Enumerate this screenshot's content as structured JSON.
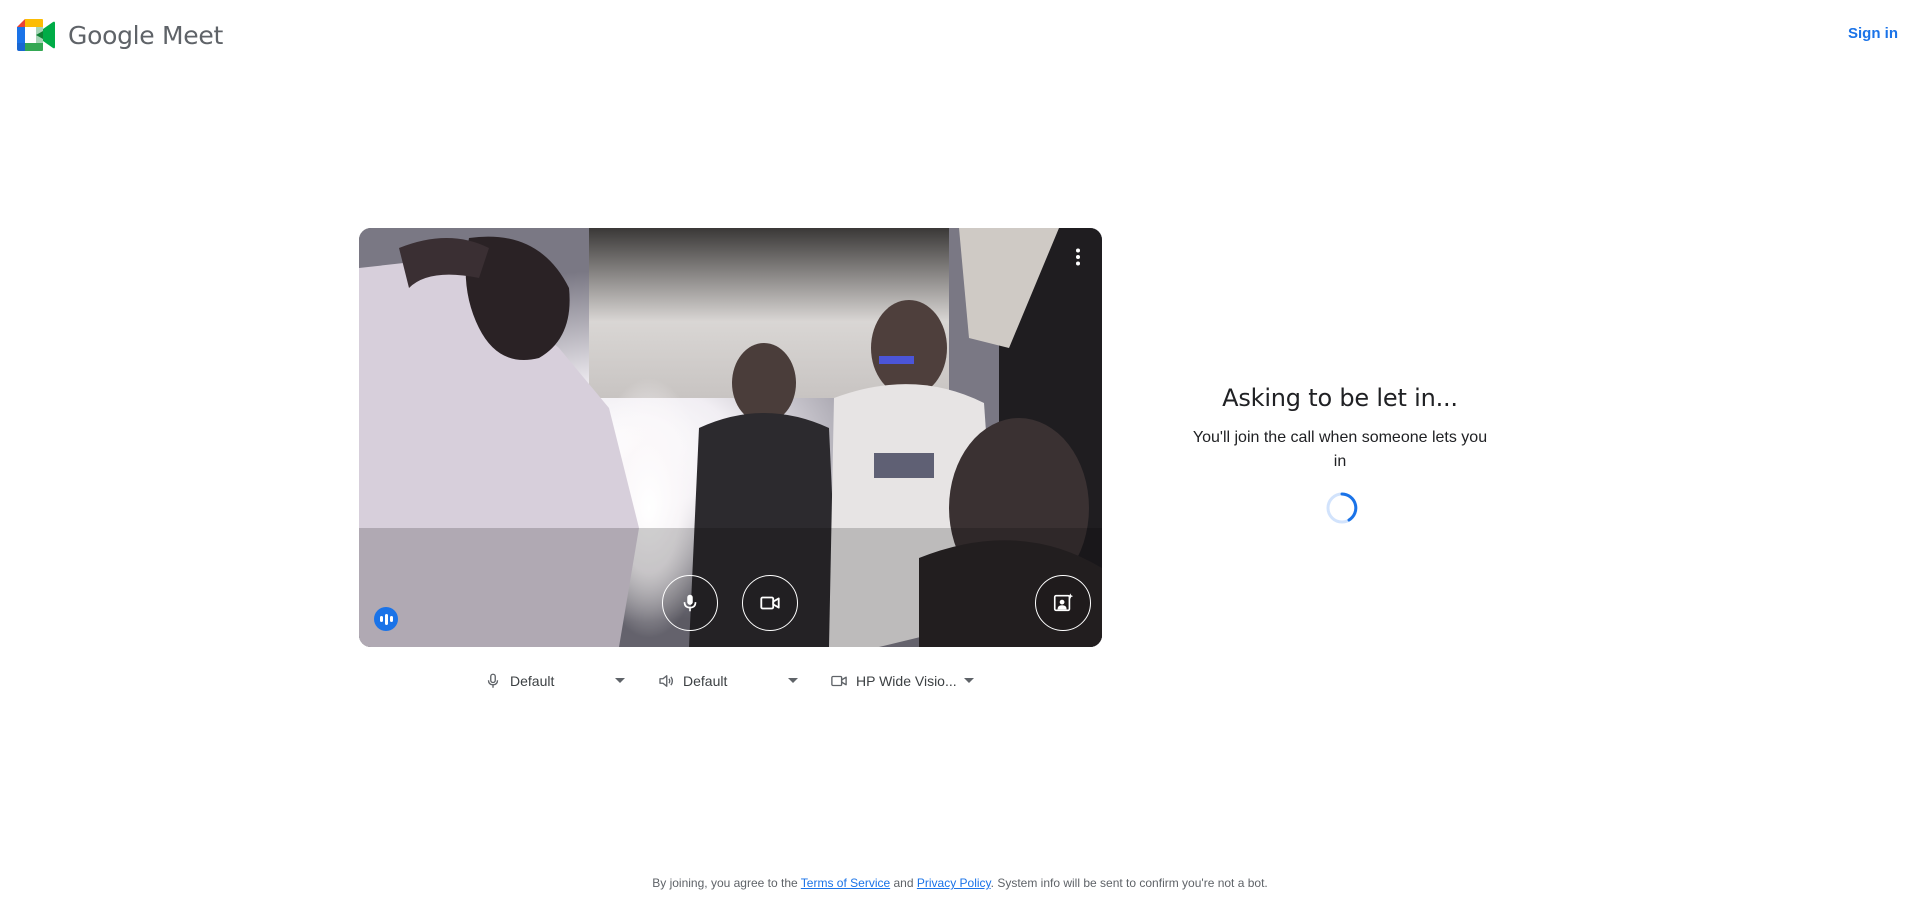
{
  "header": {
    "app_name": "Google Meet",
    "sign_in_label": "Sign in"
  },
  "preview": {
    "controls": {
      "more_icon": "more-vert-icon",
      "mic_icon": "mic-icon",
      "camera_icon": "videocam-icon",
      "effects_icon": "visual-effects-icon",
      "audio_indicator_icon": "audio-level-icon"
    }
  },
  "devices": {
    "microphone": {
      "icon": "mic-outline-icon",
      "value": "Default"
    },
    "speaker": {
      "icon": "speaker-icon",
      "value": "Default"
    },
    "camera": {
      "icon": "videocam-outline-icon",
      "value": "HP Wide Visio..."
    }
  },
  "status": {
    "title": "Asking to be let in...",
    "message": "You'll join the call when someone lets you in"
  },
  "footer": {
    "prefix": "By joining, you agree to the ",
    "terms_link": "Terms of Service",
    "and": " and ",
    "privacy_link": "Privacy Policy",
    "suffix": ". System info will be sent to confirm you're not a bot."
  },
  "colors": {
    "accent": "#1a73e8",
    "text_primary": "#202124",
    "text_secondary": "#5f6368"
  }
}
